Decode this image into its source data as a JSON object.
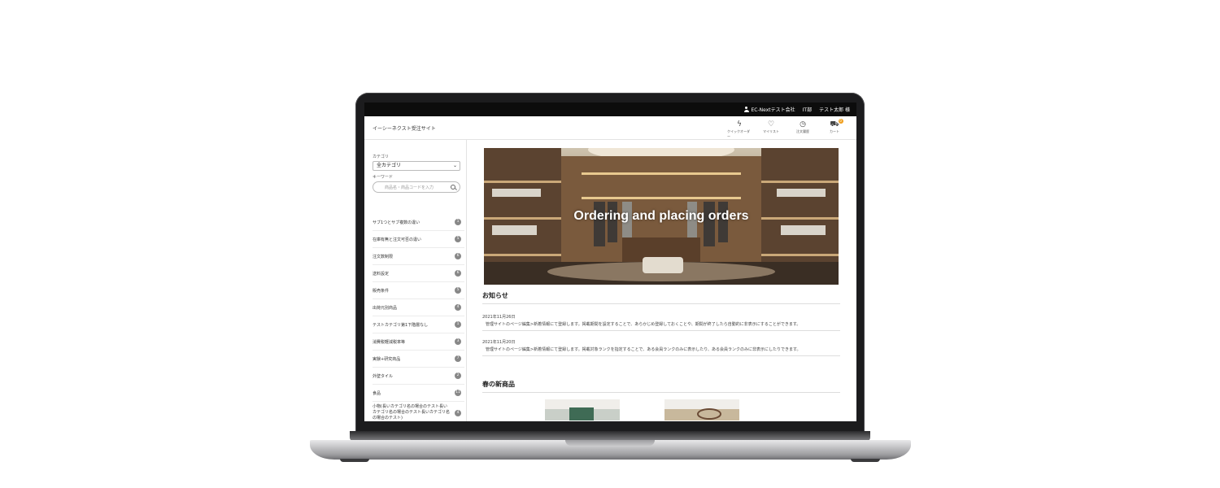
{
  "topbar": {
    "company": "EC-Nextテスト会社",
    "department": "IT部",
    "user": "テスト太郎 様"
  },
  "header": {
    "site_title": "イーシーネクスト受注サイト",
    "icons": [
      {
        "label": "クイックオーダー",
        "icon": "quick-order-icon"
      },
      {
        "label": "マイリスト",
        "icon": "heart-icon"
      },
      {
        "label": "注文履歴",
        "icon": "clock-icon"
      },
      {
        "label": "カート",
        "icon": "cart-icon"
      }
    ],
    "cart_count": "0"
  },
  "search": {
    "category_label": "カテゴリ",
    "category_value": "全カテゴリ",
    "keyword_label": "キーワード",
    "keyword_placeholder": "商品名・商品コードを入力"
  },
  "categories": [
    {
      "label": "サブ1つとサブ複数の違い",
      "count": "1"
    },
    {
      "label": "在庫有無と注文可否の違い",
      "count": "5"
    },
    {
      "label": "注文数制限",
      "count": "6"
    },
    {
      "label": "送料設定",
      "count": "6"
    },
    {
      "label": "販売条件",
      "count": "5"
    },
    {
      "label": "出荷元別商品",
      "count": "4"
    },
    {
      "label": "テストカテゴリ第1下階層なし",
      "count": "1"
    },
    {
      "label": "消費税軽減税率等",
      "count": "3"
    },
    {
      "label": "実験+研究商品",
      "count": "7"
    },
    {
      "label": "外壁タイル",
      "count": "2"
    },
    {
      "label": "食品",
      "count": "11"
    },
    {
      "label": "小物(長いカテゴリ名の場合のテスト長いカテゴリ名の場合のテスト長いカテゴリ名の場合のテスト)",
      "count": "4"
    }
  ],
  "hero": {
    "caption": "Ordering and placing orders"
  },
  "news": {
    "title": "お知らせ",
    "items": [
      {
        "date": "2021年11月26日",
        "text": "管理サイトのページ編集>新着情報にて登録します。掲載期間を設定することで、あらかじめ登録しておくことや、期間が終了したら自動的に非表示にすることができます。"
      },
      {
        "date": "2021年11月20日",
        "text": "管理サイトのページ編集>新着情報にて登録します。掲載対象ランクを指定することで、ある会員ランクのみに表示したり、ある会員ランクのみに非表示にしたりできます。"
      }
    ]
  },
  "new_products": {
    "title": "春の新商品"
  }
}
